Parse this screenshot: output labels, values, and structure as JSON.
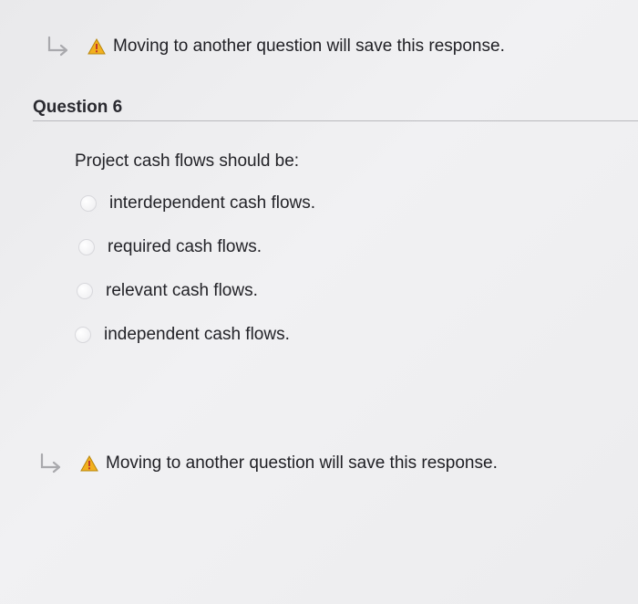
{
  "notices": {
    "top": "Moving to another question will save this response.",
    "bottom": "Moving to another question will save this response."
  },
  "icons": {
    "arrow": "return-arrow-icon",
    "warning": "warning-triangle-icon"
  },
  "colors": {
    "warning_fill": "#f2b01e",
    "warning_mark": "#c0392b",
    "arrow": "#a9a9ad"
  },
  "question": {
    "title": "Question 6",
    "prompt": "Project cash flows should be:",
    "options": [
      {
        "label": "interdependent cash flows.",
        "selected": false
      },
      {
        "label": "required cash flows.",
        "selected": false
      },
      {
        "label": "relevant cash flows.",
        "selected": false
      },
      {
        "label": "independent cash flows.",
        "selected": false
      }
    ]
  }
}
